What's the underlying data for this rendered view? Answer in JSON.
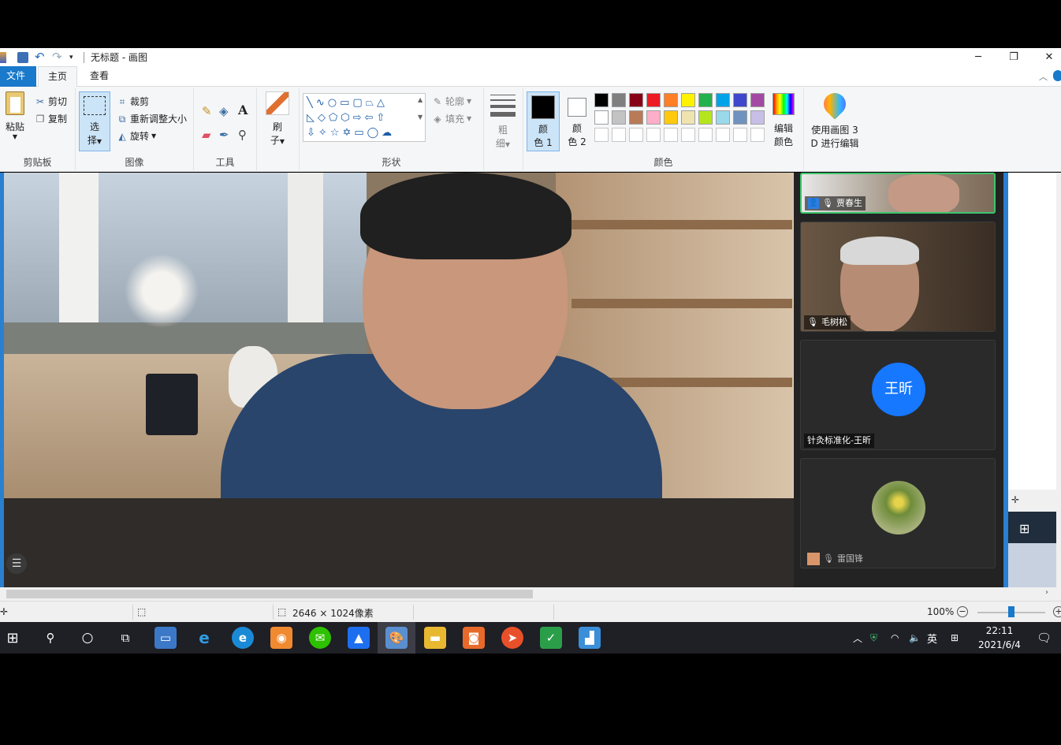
{
  "window": {
    "title": "无标题 - 画图",
    "minimize_glyph": "─",
    "restore_glyph": "❐",
    "close_glyph": "✕"
  },
  "ribbon_tabs": {
    "file": "文件",
    "home": "主页",
    "view": "查看"
  },
  "clipboard": {
    "paste": "粘贴",
    "cut": "剪切",
    "copy": "复制",
    "label": "剪贴板"
  },
  "image_group": {
    "select_top": "选",
    "select_bottom": "择",
    "crop": "裁剪",
    "resize": "重新调整大小",
    "rotate": "旋转",
    "label": "图像"
  },
  "tools_group": {
    "label": "工具",
    "text_glyph": "A"
  },
  "brushes": {
    "top": "刷",
    "bottom": "子",
    "label": ""
  },
  "shapes_group": {
    "outline": "轮廓",
    "fill": "填充",
    "label": "形状"
  },
  "size_group": {
    "top": "粗",
    "bottom": "细"
  },
  "colors_group": {
    "color1_top": "颜",
    "color1_bottom": "色 1",
    "color2_top": "颜",
    "color2_bottom": "色 2",
    "edit_top": "编辑",
    "edit_bottom": "颜色",
    "label": "颜色",
    "palette": [
      "#000000",
      "#7f7f7f",
      "#880015",
      "#ed1c24",
      "#ff7f27",
      "#fff200",
      "#22b14c",
      "#00a2e8",
      "#3f48cc",
      "#a349a4",
      "#ffffff",
      "#c3c3c3",
      "#b97a57",
      "#ffaec9",
      "#ffc90e",
      "#efe4b0",
      "#b5e61d",
      "#99d9ea",
      "#7092be",
      "#c8bfe7"
    ]
  },
  "paint3d": {
    "line1": "使用画图 3",
    "line2": "D 进行编辑"
  },
  "participants": [
    {
      "name": "贾春生"
    },
    {
      "name": "毛树松"
    },
    {
      "name": "针灸标准化-王昕",
      "avatar_text": "王昕"
    },
    {
      "name": "雷国锋"
    }
  ],
  "statusbar": {
    "dimensions": "2646 × 1024像素",
    "zoom": "100%"
  },
  "taskbar": {
    "ime": "英",
    "time": "22:11",
    "date": "2021/6/4"
  }
}
